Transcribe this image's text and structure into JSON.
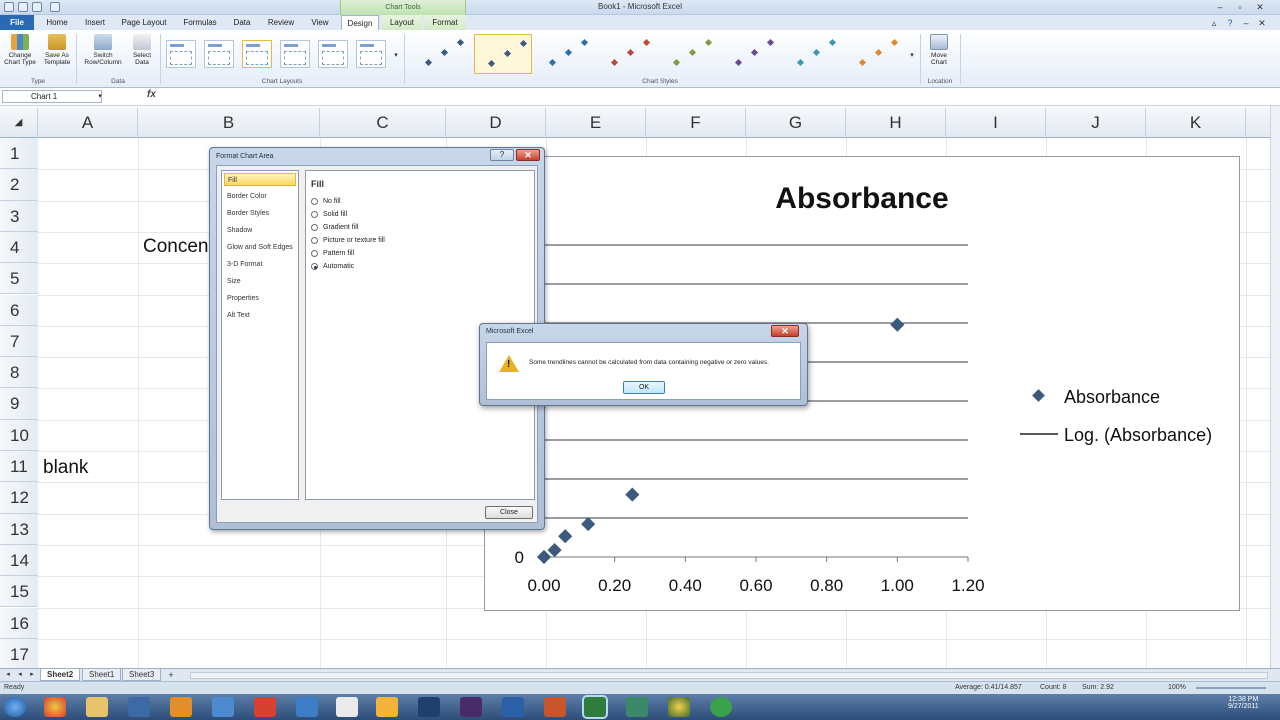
{
  "window": {
    "title": "Book1 - Microsoft Excel",
    "context_group": "Chart Tools"
  },
  "tabs": [
    {
      "label": "File"
    },
    {
      "label": "Home"
    },
    {
      "label": "Insert"
    },
    {
      "label": "Page Layout"
    },
    {
      "label": "Formulas"
    },
    {
      "label": "Data"
    },
    {
      "label": "Review"
    },
    {
      "label": "View"
    },
    {
      "label": "Design"
    },
    {
      "label": "Layout"
    },
    {
      "label": "Format"
    }
  ],
  "ribbon": {
    "change_chart_type": "Change Chart Type",
    "save_as_template": "Save As Template",
    "switch_row_column": "Switch Row/Column",
    "select_data": "Select Data",
    "move_chart": "Move Chart",
    "group_type": "Type",
    "group_data": "Data",
    "group_chart_layouts": "Chart Layouts",
    "group_chart_styles": "Chart Styles",
    "group_location": "Location"
  },
  "formula_bar": {
    "name_box": "Chart 1",
    "fx": "fx"
  },
  "columns": [
    "A",
    "B",
    "C",
    "D",
    "E",
    "F",
    "G",
    "H",
    "I",
    "J",
    "K"
  ],
  "rows": [
    "1",
    "2",
    "3",
    "4",
    "5",
    "6",
    "7",
    "8",
    "9",
    "10",
    "11",
    "12",
    "13",
    "14",
    "15",
    "16",
    "17"
  ],
  "cells": {
    "b4": "Concen",
    "a11": "blank"
  },
  "chart_data": {
    "type": "scatter",
    "title": "Absorbance",
    "xlabel": "",
    "ylabel": "",
    "x_ticks": [
      "0.00",
      "0.20",
      "0.40",
      "0.60",
      "0.80",
      "1.00",
      "1.20"
    ],
    "y_tick_label": "0",
    "xlim": [
      0,
      1.2
    ],
    "series": [
      {
        "name": "Absorbance",
        "marker": "diamond",
        "color": "#3b5a7e",
        "x": [
          0.0,
          0.03,
          0.06,
          0.125,
          0.25,
          1.0
        ],
        "y": [
          0.0,
          0.02,
          0.06,
          0.095,
          0.18,
          0.67
        ]
      }
    ],
    "trendline": {
      "name": "Log. (Absorbance)",
      "color": "#222222"
    },
    "legend": {
      "placement": "right",
      "entries": [
        "Absorbance",
        "Log. (Absorbance)"
      ]
    },
    "grid": "horizontal"
  },
  "format_dialog": {
    "title": "Format Chart Area",
    "nav": [
      "Fill",
      "Border Color",
      "Border Styles",
      "Shadow",
      "Glow and Soft Edges",
      "3-D Format",
      "Size",
      "Properties",
      "Alt Text"
    ],
    "heading": "Fill",
    "options": [
      "No fill",
      "Solid fill",
      "Gradient fill",
      "Picture or texture fill",
      "Pattern fill",
      "Automatic"
    ],
    "close": "Close",
    "help": "?",
    "x": "✕"
  },
  "message_box": {
    "title": "Microsoft Excel",
    "text": "Some trendlines cannot be calculated from data containing negative or zero values.",
    "ok": "OK",
    "x": "✕"
  },
  "sheets": [
    "Sheet2",
    "Sheet1",
    "Sheet3"
  ],
  "status": {
    "ready": "Ready",
    "average": "Average: 0.41/14.857",
    "count": "Count: 8",
    "sum": "Sum: 2.92",
    "zoom": "100%"
  },
  "clock": {
    "time": "12:38 PM",
    "date": "9/27/2011"
  }
}
